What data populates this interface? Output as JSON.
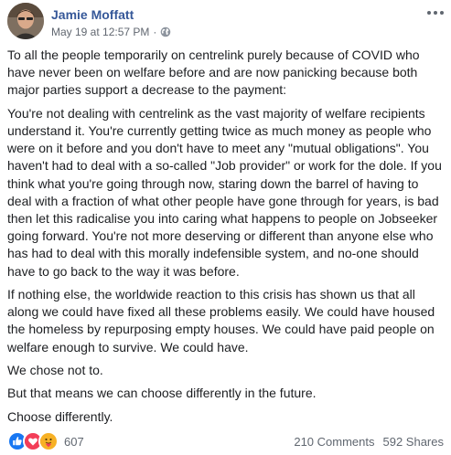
{
  "post": {
    "author": "Jamie Moffatt",
    "timestamp": "May 19 at 12:57 PM",
    "separator": "·",
    "audience_icon": "globe-icon",
    "more_icon": "more-options-icon",
    "paragraphs": [
      "To all the people temporarily on centrelink purely because of COVID who have never been on welfare before and are now panicking because both major parties support a decrease to the payment:",
      "You're not dealing with centrelink as the vast majority of welfare recipients understand it. You're currently getting twice as much money as people who were on it before and you don't have to meet any \"mutual obligations\". You haven't had to deal with a so-called \"Job provider\" or work for the dole. If you think what you're going through now, staring down the barrel of having to deal with a fraction of what other people have gone through for years, is bad then let this radicalise you into caring what happens to people on Jobseeker going forward. You're not more deserving or different than anyone else who has had to deal with this morally indefensible system, and no-one should have to go back to the way it was before.",
      "If nothing else, the worldwide reaction to this crisis has shown us that all along we could have fixed all these problems easily. We could have housed the homeless by repurposing empty houses. We could have paid people on welfare enough to survive. We could have.",
      "We chose not to.",
      "But that means we can choose differently in the future.",
      "Choose differently."
    ]
  },
  "footer": {
    "reactions": [
      "like",
      "love",
      "care"
    ],
    "reaction_count": "607",
    "comments": "210 Comments",
    "shares": "592 Shares"
  },
  "colors": {
    "author": "#365899",
    "like": "#1877f2",
    "love": "#f33e58",
    "care": "#f7b125",
    "meta": "#616770"
  }
}
